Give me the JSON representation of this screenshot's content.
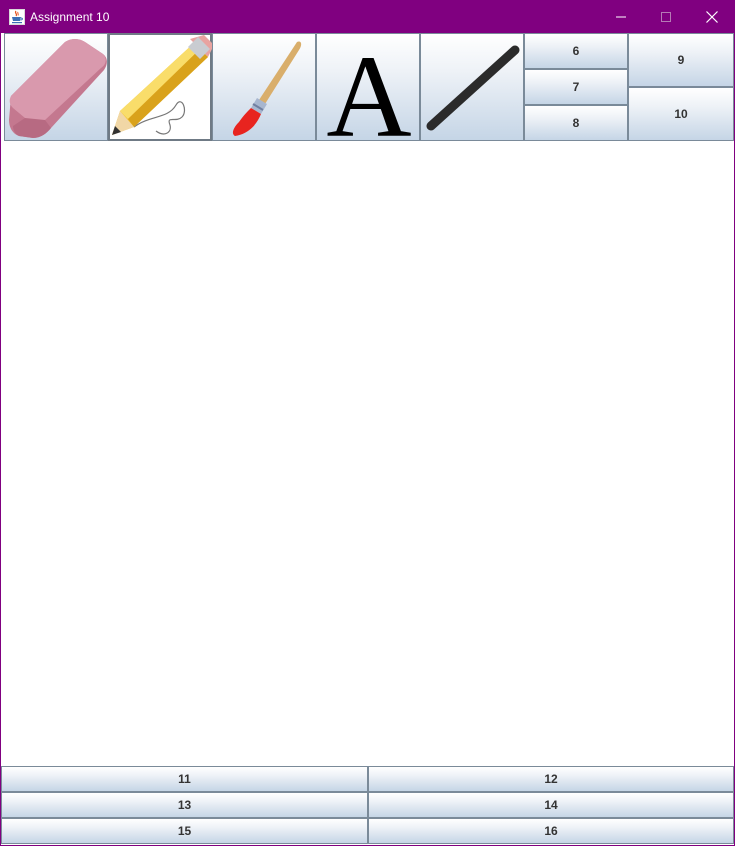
{
  "window": {
    "title": "Assignment 10",
    "title_bar_color": "#800080",
    "app_icon": "java-coffee-cup-icon",
    "controls": {
      "minimize": "minimize-icon",
      "maximize": "maximize-icon",
      "close": "close-icon"
    }
  },
  "toolbar": {
    "tools": [
      {
        "id": "eraser",
        "icon": "eraser-icon",
        "selected": false
      },
      {
        "id": "pencil",
        "icon": "pencil-icon",
        "selected": true
      },
      {
        "id": "brush",
        "icon": "paintbrush-icon",
        "selected": false
      },
      {
        "id": "text",
        "icon": "text-a-icon",
        "glyph": "A",
        "selected": false
      },
      {
        "id": "line",
        "icon": "line-icon",
        "selected": false
      }
    ],
    "buttons": [
      "6",
      "7",
      "8",
      "9",
      "10"
    ]
  },
  "bottom_buttons": [
    "11",
    "12",
    "13",
    "14",
    "15",
    "16"
  ]
}
